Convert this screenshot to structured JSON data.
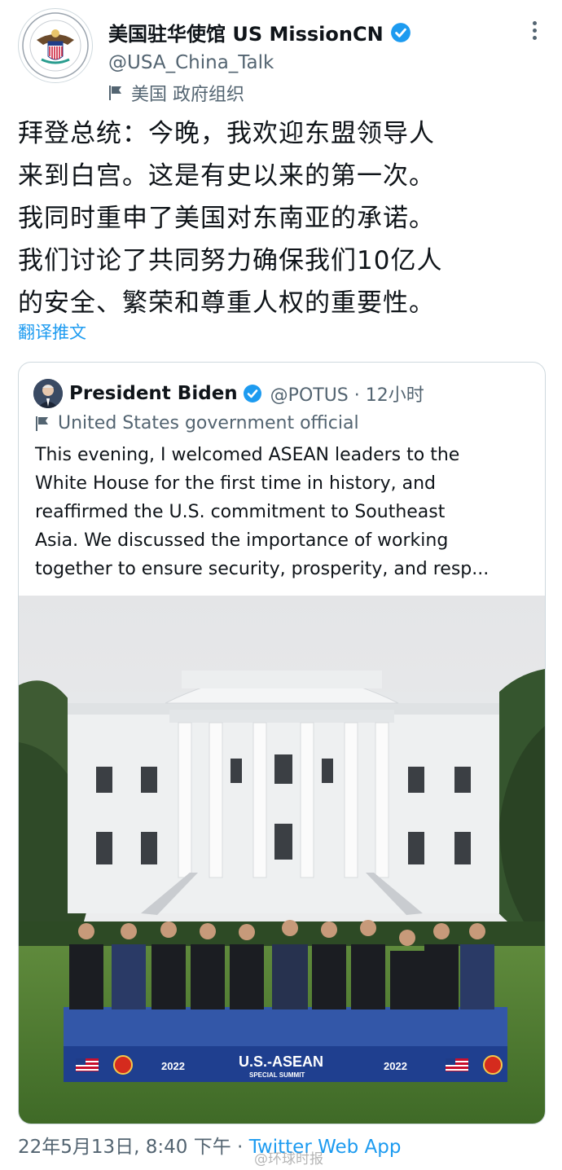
{
  "author": {
    "name": "美国驻华使馆 US MissionCN",
    "handle": "@USA_China_Talk",
    "label": "美国 政府组织"
  },
  "tweet": {
    "text": "拜登总统：今晚，我欢迎东盟领导人\n来到白宫。这是有史以来的第一次。\n我同时重申了美国对东南亚的承诺。\n我们讨论了共同努力确保我们10亿人\n的安全、繁荣和尊重人权的重要性。",
    "translate_label": "翻译推文"
  },
  "quoted": {
    "name": "President Biden",
    "handle": "@POTUS · 12小时",
    "label": "United States government official",
    "text": "This evening, I welcomed ASEAN leaders to the\nWhite House for the first time in history, and\nreaffirmed the U.S. commitment to Southeast\nAsia. We discussed the importance of working\ntogether to ensure security, prosperity, and resp...",
    "photo": {
      "stage_year_left": "2022",
      "stage_title": "U.S.-ASEAN",
      "stage_subtitle": "SPECIAL SUMMIT",
      "stage_year_right": "2022"
    }
  },
  "footer": {
    "timestamp": "22年5月13日, 8:40 下午 · ",
    "app": "Twitter Web App"
  },
  "watermark": "@环球时报",
  "colors": {
    "accent": "#1d9bf0",
    "muted": "#536471",
    "border": "#cfd9de"
  },
  "icons": [
    "seal-avatar-icon",
    "verified-badge-icon",
    "government-flag-icon",
    "more-options-icon"
  ]
}
